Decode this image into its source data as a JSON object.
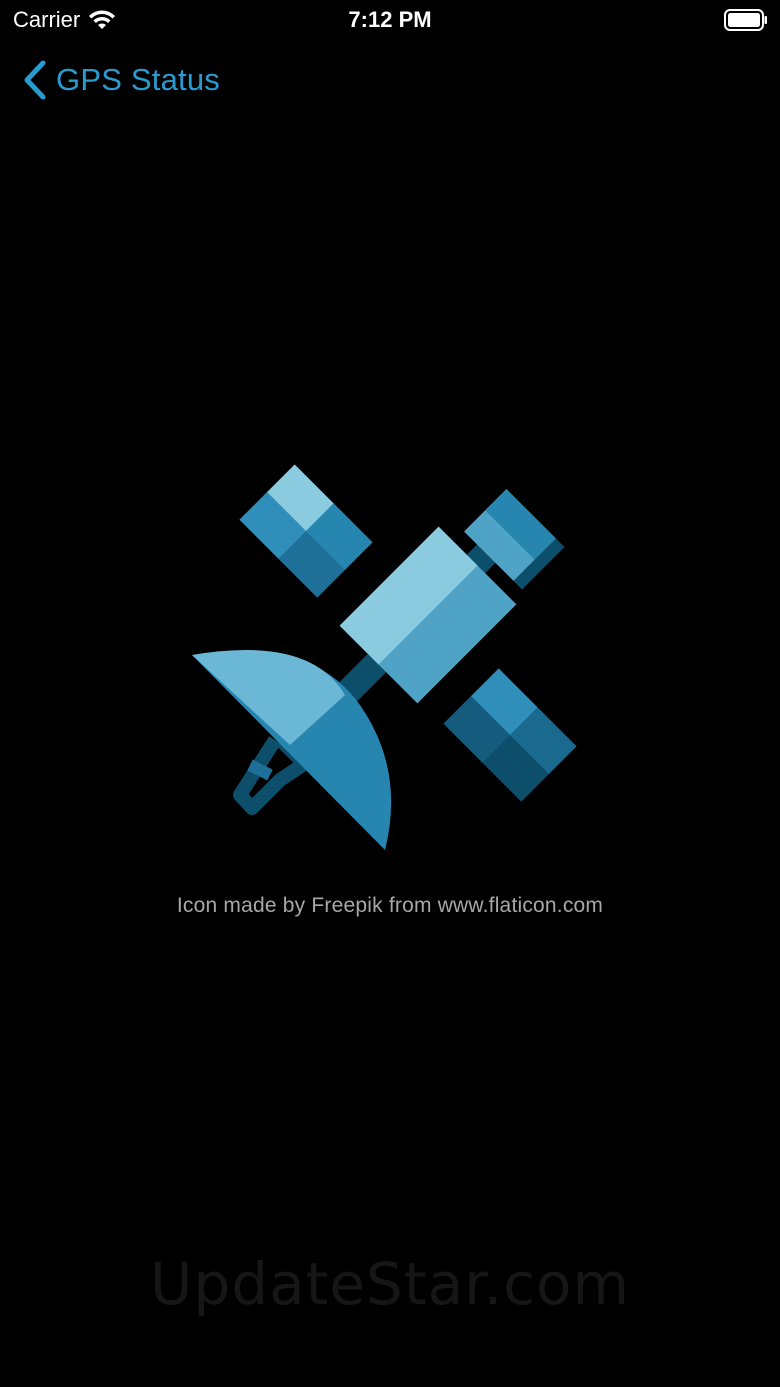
{
  "status_bar": {
    "carrier": "Carrier",
    "time": "7:12 PM",
    "wifi_icon": "wifi-icon",
    "battery_icon": "battery-icon"
  },
  "nav": {
    "back_label": "GPS Status",
    "back_icon": "chevron-left-icon"
  },
  "content": {
    "illustration": "satellite-icon",
    "credit": "Icon made by Freepik from www.flaticon.com"
  },
  "watermark": "UpdateStar.com",
  "colors": {
    "background": "#000000",
    "accent": "#2a9bd0",
    "credit_text": "#a7a7a7",
    "sat_light": "#8acbe0",
    "sat_mid": "#4fa3c6",
    "sat_dark": "#1f7099",
    "sat_darker": "#0d4f6b"
  }
}
